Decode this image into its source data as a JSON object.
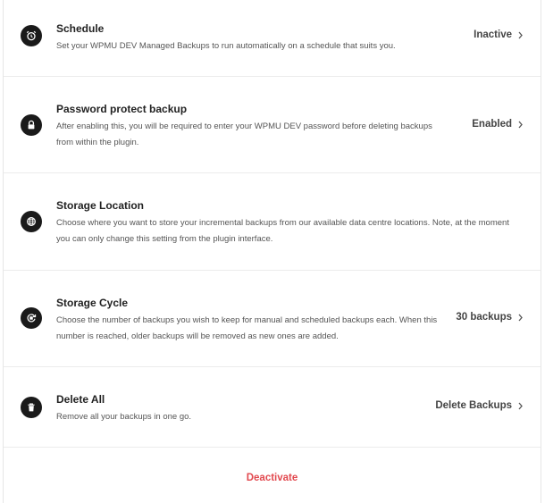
{
  "settings": [
    {
      "title": "Schedule",
      "desc": "Set your WPMU DEV Managed Backups to run automatically on a schedule that suits you.",
      "action": "Inactive",
      "icon": "alarm-clock-icon"
    },
    {
      "title": "Password protect backup",
      "desc": "After enabling this, you will be required to enter your WPMU DEV password before deleting backups from within the plugin.",
      "action": "Enabled",
      "icon": "lock-icon"
    },
    {
      "title": "Storage Location",
      "desc": "Choose where you want to store your incremental backups from our available data centre locations. Note, at the moment you can only change this setting from the plugin interface.",
      "action": "",
      "icon": "globe-icon"
    },
    {
      "title": "Storage Cycle",
      "desc": "Choose the number of backups you wish to keep for manual and scheduled backups each. When this number is reached, older backups will be removed as new ones are added.",
      "action": "30 backups",
      "icon": "storage-cycle-icon"
    },
    {
      "title": "Delete All",
      "desc": "Remove all your backups in one go.",
      "action": "Delete Backups",
      "icon": "trash-icon"
    }
  ],
  "footer": {
    "deactivate_label": "Deactivate"
  },
  "colors": {
    "icon_bg": "#1a1a1a",
    "danger": "#e2494f",
    "border": "#ececec"
  }
}
